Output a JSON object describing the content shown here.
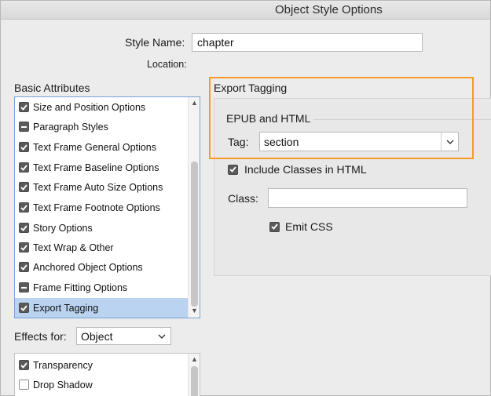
{
  "window": {
    "title": "Object Style Options"
  },
  "style_name": {
    "label": "Style Name:",
    "value": "chapter"
  },
  "location": {
    "label": "Location:"
  },
  "basic_attributes": {
    "heading": "Basic Attributes",
    "items": [
      {
        "label": "Size and Position Options",
        "state": "checked"
      },
      {
        "label": "Paragraph Styles",
        "state": "mixed"
      },
      {
        "label": "Text Frame General Options",
        "state": "checked"
      },
      {
        "label": "Text Frame Baseline Options",
        "state": "checked"
      },
      {
        "label": "Text Frame Auto Size Options",
        "state": "checked"
      },
      {
        "label": "Text Frame Footnote Options",
        "state": "checked"
      },
      {
        "label": "Story Options",
        "state": "checked"
      },
      {
        "label": "Text Wrap & Other",
        "state": "checked"
      },
      {
        "label": "Anchored Object Options",
        "state": "checked"
      },
      {
        "label": "Frame Fitting Options",
        "state": "mixed"
      },
      {
        "label": "Export Tagging",
        "state": "checked",
        "selected": true
      }
    ]
  },
  "effects": {
    "label": "Effects for:",
    "selected": "Object",
    "items": [
      {
        "label": "Transparency",
        "state": "checked"
      },
      {
        "label": "Drop Shadow",
        "state": "unchecked"
      }
    ]
  },
  "export_tagging": {
    "heading": "Export Tagging",
    "subheading": "EPUB and HTML",
    "tag_label": "Tag:",
    "tag_value": "section",
    "include_classes_label": "Include Classes in HTML",
    "class_label": "Class:",
    "class_value": "",
    "emit_css_label": "Emit CSS"
  },
  "colors": {
    "highlight": "#f59a2b",
    "selection": "#b9d3f1",
    "list_border": "#7aa0d6"
  }
}
